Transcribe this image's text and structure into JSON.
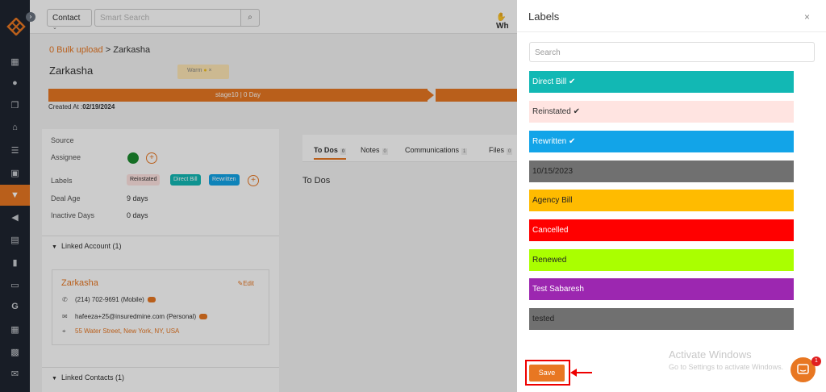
{
  "sidebar": {
    "icons": [
      "dashboard-icon",
      "people-icon",
      "copy-icon",
      "bank-icon",
      "list-icon",
      "contact-icon",
      "funnel-icon",
      "megaphone-icon",
      "document-icon",
      "chart-icon",
      "folder-icon",
      "google-icon",
      "calculator-icon",
      "calendar-icon",
      "mail-icon"
    ],
    "toggle": "›"
  },
  "topbar": {
    "context": "Contact",
    "search_placeholder": "Smart Search",
    "user_text": "Wh"
  },
  "breadcrumb": {
    "first": "0 Bulk upload",
    "sep": " > ",
    "current": "Zarkasha"
  },
  "contact": {
    "name": "Zarkasha",
    "warm_tag": "Warm",
    "warm_x": "×",
    "stage": "stage10 | 0 Day",
    "created_label": "Created At :",
    "created_value": "02/19/2024"
  },
  "details": {
    "source_label": "Source",
    "assignee_label": "Assignee",
    "labels_label": "Labels",
    "labels": [
      {
        "text": "Reinstated",
        "bg": "#ffe4e1",
        "color": "#333"
      },
      {
        "text": "Direct Bill",
        "bg": "#12b8b4",
        "color": "#fff"
      },
      {
        "text": "Rewritten",
        "bg": "#12a4e8",
        "color": "#fff"
      }
    ],
    "deal_age_label": "Deal Age",
    "deal_age": "9 days",
    "inactive_label": "Inactive Days",
    "inactive": "0 days"
  },
  "linked_account": {
    "header": "Linked Account (1)",
    "name": "Zarkasha",
    "edit": "Edit",
    "phone": "(214) 702-9691 (Mobile)",
    "email": "hafeeza+25@insuredmine.com (Personal)",
    "address": "55 Water Street, New York, NY, USA"
  },
  "linked_contacts": {
    "header": "Linked Contacts (1)"
  },
  "tabs": [
    {
      "label": "To Dos",
      "count": "0"
    },
    {
      "label": "Notes",
      "count": "0"
    },
    {
      "label": "Communications",
      "count": "1"
    },
    {
      "label": "Files",
      "count": "0"
    }
  ],
  "todos_heading": "To Dos",
  "modal": {
    "title": "Labels",
    "close": "×",
    "search_placeholder": "Search",
    "labels": [
      {
        "text": "Direct Bill ✔",
        "bg": "#12b8b4",
        "color": "#ffffff"
      },
      {
        "text": "Reinstated ✔",
        "bg": "#ffe4e1",
        "color": "#333333"
      },
      {
        "text": "Rewritten ✔",
        "bg": "#12a4e8",
        "color": "#ffffff"
      },
      {
        "text": "10/15/2023",
        "bg": "#707070",
        "color": "#222222"
      },
      {
        "text": "Agency Bill",
        "bg": "#ffbb00",
        "color": "#222222"
      },
      {
        "text": "Cancelled",
        "bg": "#ff0000",
        "color": "#ffffff"
      },
      {
        "text": "Renewed",
        "bg": "#aaff00",
        "color": "#222222"
      },
      {
        "text": "Test Sabaresh",
        "bg": "#9c27b0",
        "color": "#ffffff"
      },
      {
        "text": "tested",
        "bg": "#707070",
        "color": "#222222"
      }
    ],
    "save": "Save"
  },
  "watermark": {
    "line1": "Activate Windows",
    "line2": "Go to Settings to activate Windows."
  },
  "chat": {
    "badge": "1"
  },
  "colors": {
    "accent": "#e87722",
    "sidebar": "#1e2530",
    "highlight": "#e00000"
  }
}
